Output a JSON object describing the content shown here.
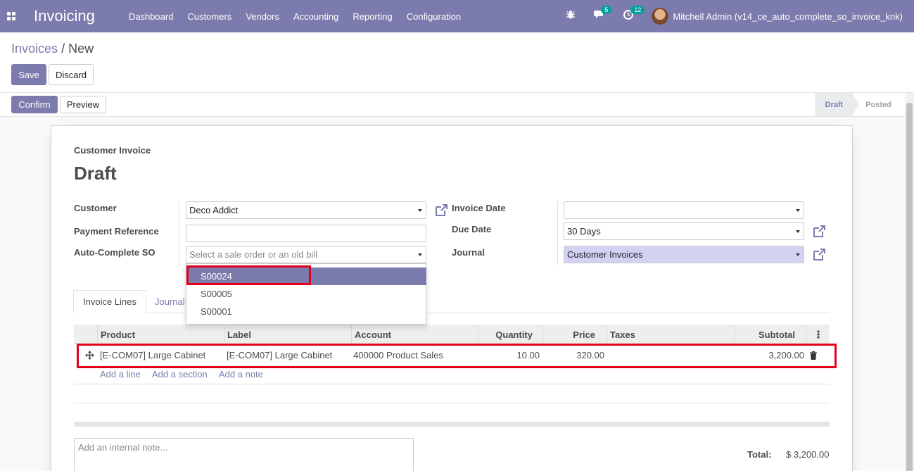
{
  "navbar": {
    "app_name": "Invoicing",
    "menu": [
      "Dashboard",
      "Customers",
      "Vendors",
      "Accounting",
      "Reporting",
      "Configuration"
    ],
    "messages_count": "5",
    "activities_count": "12",
    "user": "Mitchell Admin (v14_ce_auto_complete_so_invoice_knk)"
  },
  "breadcrumb": {
    "parent": "Invoices",
    "separator": "/",
    "current": "New"
  },
  "actions": {
    "save": "Save",
    "discard": "Discard"
  },
  "statusbar": {
    "confirm": "Confirm",
    "preview": "Preview",
    "stages": [
      "Draft",
      "Posted"
    ],
    "active_stage": "Draft"
  },
  "form": {
    "doc_type": "Customer Invoice",
    "title": "Draft",
    "customer_label": "Customer",
    "customer_value": "Deco Addict",
    "payment_ref_label": "Payment Reference",
    "payment_ref_value": "",
    "auto_so_label": "Auto-Complete SO",
    "auto_so_placeholder": "Select a sale order or an old bill",
    "invoice_date_label": "Invoice Date",
    "invoice_date_value": "",
    "due_date_label": "Due Date",
    "due_date_value": "30 Days",
    "journal_label": "Journal",
    "journal_value": "Customer Invoices"
  },
  "dropdown": {
    "options": [
      "S00024",
      "S00005",
      "S00001"
    ],
    "active_index": 0
  },
  "tabs": [
    "Invoice Lines",
    "Journal"
  ],
  "table": {
    "headers": [
      "Product",
      "Label",
      "Account",
      "Quantity",
      "Price",
      "Taxes",
      "Subtotal"
    ],
    "rows": [
      {
        "product": "[E-COM07] Large Cabinet",
        "label": "[E-COM07] Large Cabinet",
        "account": "400000 Product Sales",
        "quantity": "10.00",
        "price": "320.00",
        "taxes": "",
        "subtotal": "3,200.00"
      }
    ],
    "add_line": "Add a line",
    "add_section": "Add a section",
    "add_note": "Add a note"
  },
  "note_placeholder": "Add an internal note...",
  "totals": {
    "label": "Total:",
    "value": "$ 3,200.00"
  },
  "colors": {
    "brand": "#7c7bad",
    "highlight": "#e3001b",
    "journal_bg": "#d3d2f3"
  }
}
